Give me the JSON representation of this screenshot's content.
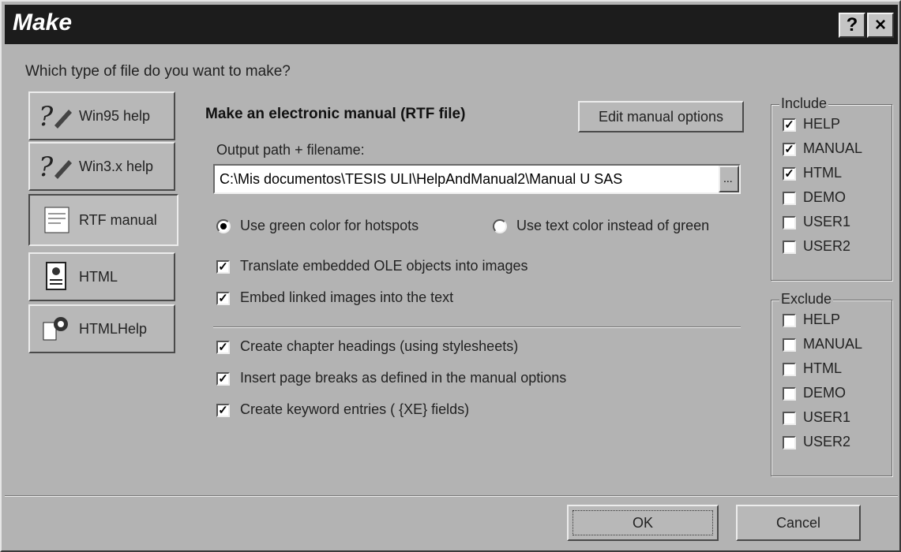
{
  "window": {
    "title": "Make",
    "help_button": "?",
    "close_button": "×"
  },
  "question": "Which type of file do you want to make?",
  "type_buttons": [
    {
      "label": "Win95 help",
      "icon": "help-pen-icon"
    },
    {
      "label": "Win3.x help",
      "icon": "help-pen-icon"
    },
    {
      "label": "RTF manual",
      "icon": "rtf-document-icon"
    },
    {
      "label": "HTML",
      "icon": "html-page-icon"
    },
    {
      "label": "HTMLHelp",
      "icon": "htmlhelp-icon"
    }
  ],
  "main": {
    "heading": "Make an electronic manual (RTF file)",
    "edit_options_button": "Edit manual options",
    "output_label": "Output path + filename:",
    "output_value": "C:\\Mis documentos\\TESIS ULI\\HelpAndManual2\\Manual U SAS",
    "browse_button": "...",
    "radio_green": "Use green color for hotspots",
    "radio_text": "Use text color instead of green",
    "checks": [
      {
        "label": "Translate embedded OLE objects into images",
        "checked": true
      },
      {
        "label": "Embed linked images into the text",
        "checked": true
      },
      {
        "label": "Create chapter headings (using stylesheets)",
        "checked": true
      },
      {
        "label": "Insert page breaks as defined in the manual options",
        "checked": true
      },
      {
        "label": "Create keyword entries ( {XE} fields)",
        "checked": true
      }
    ]
  },
  "include": {
    "label": "Include",
    "items": [
      {
        "label": "HELP",
        "checked": true
      },
      {
        "label": "MANUAL",
        "checked": true
      },
      {
        "label": "HTML",
        "checked": true
      },
      {
        "label": "DEMO",
        "checked": false
      },
      {
        "label": "USER1",
        "checked": false
      },
      {
        "label": "USER2",
        "checked": false
      }
    ]
  },
  "exclude": {
    "label": "Exclude",
    "items": [
      {
        "label": "HELP",
        "checked": false
      },
      {
        "label": "MANUAL",
        "checked": false
      },
      {
        "label": "HTML",
        "checked": false
      },
      {
        "label": "DEMO",
        "checked": false
      },
      {
        "label": "USER1",
        "checked": false
      },
      {
        "label": "USER2",
        "checked": false
      }
    ]
  },
  "footer": {
    "ok": "OK",
    "cancel": "Cancel"
  },
  "check_mark": "✓"
}
